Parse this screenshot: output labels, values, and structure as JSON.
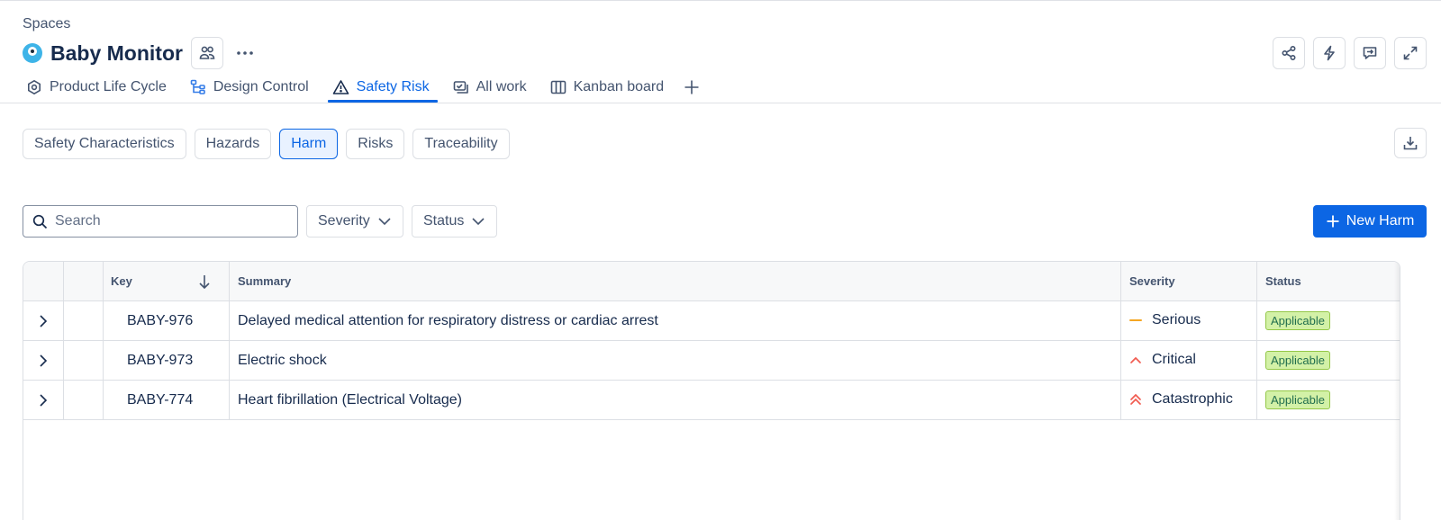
{
  "breadcrumb": "Spaces",
  "space": {
    "title": "Baby Monitor"
  },
  "tabs": [
    {
      "label": "Product Life Cycle",
      "icon": "lifecycle-icon"
    },
    {
      "label": "Design Control",
      "icon": "tree-icon"
    },
    {
      "label": "Safety Risk",
      "icon": "warning-icon",
      "active": true
    },
    {
      "label": "All work",
      "icon": "work-items-icon"
    },
    {
      "label": "Kanban board",
      "icon": "board-icon"
    }
  ],
  "subtabs": [
    "Safety Characteristics",
    "Hazards",
    "Harm",
    "Risks",
    "Traceability"
  ],
  "active_subtab": "Harm",
  "search": {
    "placeholder": "Search",
    "value": ""
  },
  "filters": {
    "severity": "Severity",
    "status": "Status"
  },
  "new_button": "New Harm",
  "table": {
    "headers": {
      "key": "Key",
      "summary": "Summary",
      "severity": "Severity",
      "status": "Status"
    },
    "rows": [
      {
        "key": "BABY-976",
        "summary": "Delayed medical attention for respiratory distress or cardiac arrest",
        "severity": "Serious",
        "status": "Applicable"
      },
      {
        "key": "BABY-973",
        "summary": "Electric shock",
        "severity": "Critical",
        "status": "Applicable"
      },
      {
        "key": "BABY-774",
        "summary": "Heart fibrillation (Electrical Voltage)",
        "severity": "Catastrophic",
        "status": "Applicable"
      }
    ]
  },
  "colors": {
    "accent": "#0c66e4",
    "severity_serious": "#f5a623",
    "severity_critical": "#f15b50",
    "badge_bg": "#d3f1a7"
  }
}
